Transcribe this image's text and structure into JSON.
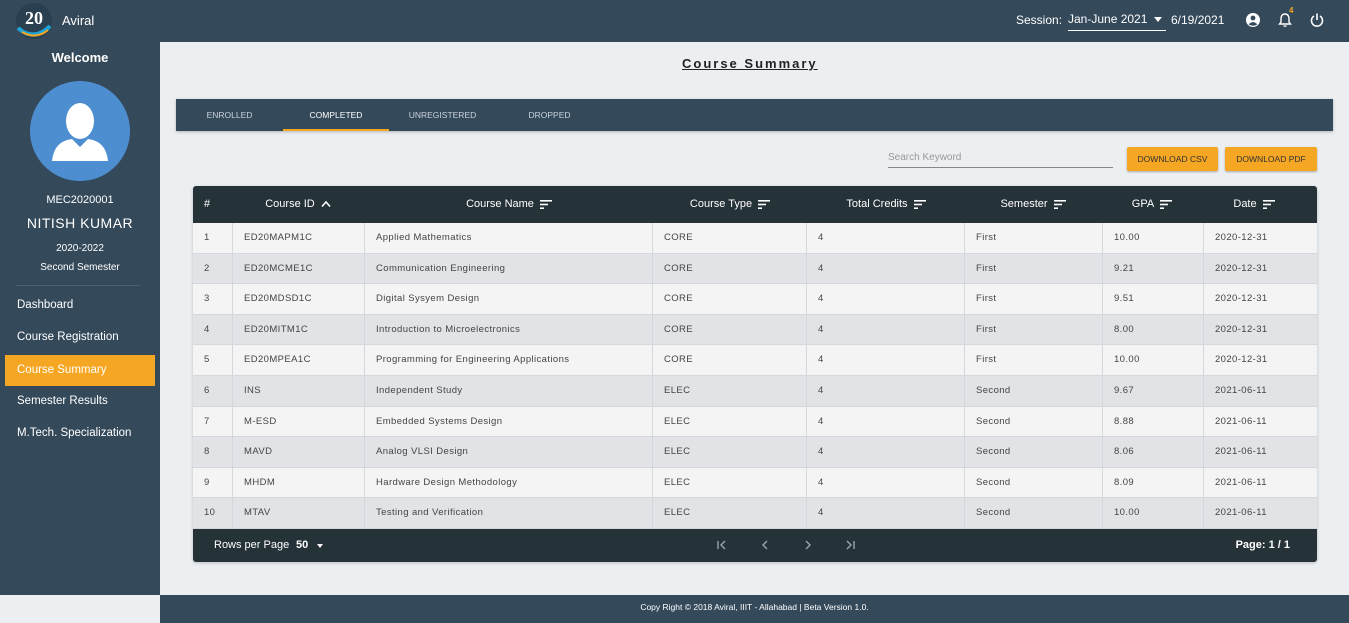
{
  "app": {
    "title": "Aviral",
    "logo_text": "20"
  },
  "topbar": {
    "session_label": "Session:",
    "session_value": "Jan-June 2021",
    "date": "6/19/2021",
    "notification_count": "4"
  },
  "sidebar": {
    "welcome": "Welcome",
    "user_id": "MEC2020001",
    "user_name": "NITISH KUMAR",
    "batch": "2020-2022",
    "semester": "Second Semester",
    "items": [
      {
        "label": "Dashboard"
      },
      {
        "label": "Course Registration"
      },
      {
        "label": "Course Summary"
      },
      {
        "label": "Semester Results"
      },
      {
        "label": "M.Tech. Specialization"
      }
    ]
  },
  "main": {
    "title": "Course Summary",
    "tabs": [
      {
        "label": "ENROLLED"
      },
      {
        "label": "COMPLETED"
      },
      {
        "label": "UNREGISTERED"
      },
      {
        "label": "DROPPED"
      }
    ],
    "search_placeholder": "Search Keyword",
    "download_csv": "DOWNLOAD CSV",
    "download_pdf": "DOWNLOAD PDF"
  },
  "table": {
    "columns": [
      "#",
      "Course ID",
      "Course Name",
      "Course Type",
      "Total Credits",
      "Semester",
      "GPA",
      "Date"
    ],
    "rows": [
      [
        "1",
        "ED20MAPM1C",
        "Applied Mathematics",
        "CORE",
        "4",
        "First",
        "10.00",
        "2020-12-31"
      ],
      [
        "2",
        "ED20MCME1C",
        "Communication Engineering",
        "CORE",
        "4",
        "First",
        "9.21",
        "2020-12-31"
      ],
      [
        "3",
        "ED20MDSD1C",
        "Digital Sysyem Design",
        "CORE",
        "4",
        "First",
        "9.51",
        "2020-12-31"
      ],
      [
        "4",
        "ED20MITM1C",
        "Introduction to Microelectronics",
        "CORE",
        "4",
        "First",
        "8.00",
        "2020-12-31"
      ],
      [
        "5",
        "ED20MPEA1C",
        "Programming for Engineering Applications",
        "CORE",
        "4",
        "First",
        "10.00",
        "2020-12-31"
      ],
      [
        "6",
        "INS",
        "Independent Study",
        "ELEC",
        "4",
        "Second",
        "9.67",
        "2021-06-11"
      ],
      [
        "7",
        "M-ESD",
        "Embedded Systems Design",
        "ELEC",
        "4",
        "Second",
        "8.88",
        "2021-06-11"
      ],
      [
        "8",
        "MAVD",
        "Analog VLSI Design",
        "ELEC",
        "4",
        "Second",
        "8.06",
        "2021-06-11"
      ],
      [
        "9",
        "MHDM",
        "Hardware Design Methodology",
        "ELEC",
        "4",
        "Second",
        "8.09",
        "2021-06-11"
      ],
      [
        "10",
        "MTAV",
        "Testing and Verification",
        "ELEC",
        "4",
        "Second",
        "10.00",
        "2021-06-11"
      ]
    ],
    "rows_per_page_label": "Rows per Page",
    "rows_per_page": "50",
    "page_info": "Page: 1 / 1"
  },
  "footer": {
    "text": "Copy Right © 2018 Aviral, IIIT - Allahabad | Beta Version 1.0."
  },
  "colors": {
    "navy": "#34495a",
    "accent": "#f5a623",
    "table_header": "#253238",
    "avatar": "#4d8ed1"
  }
}
